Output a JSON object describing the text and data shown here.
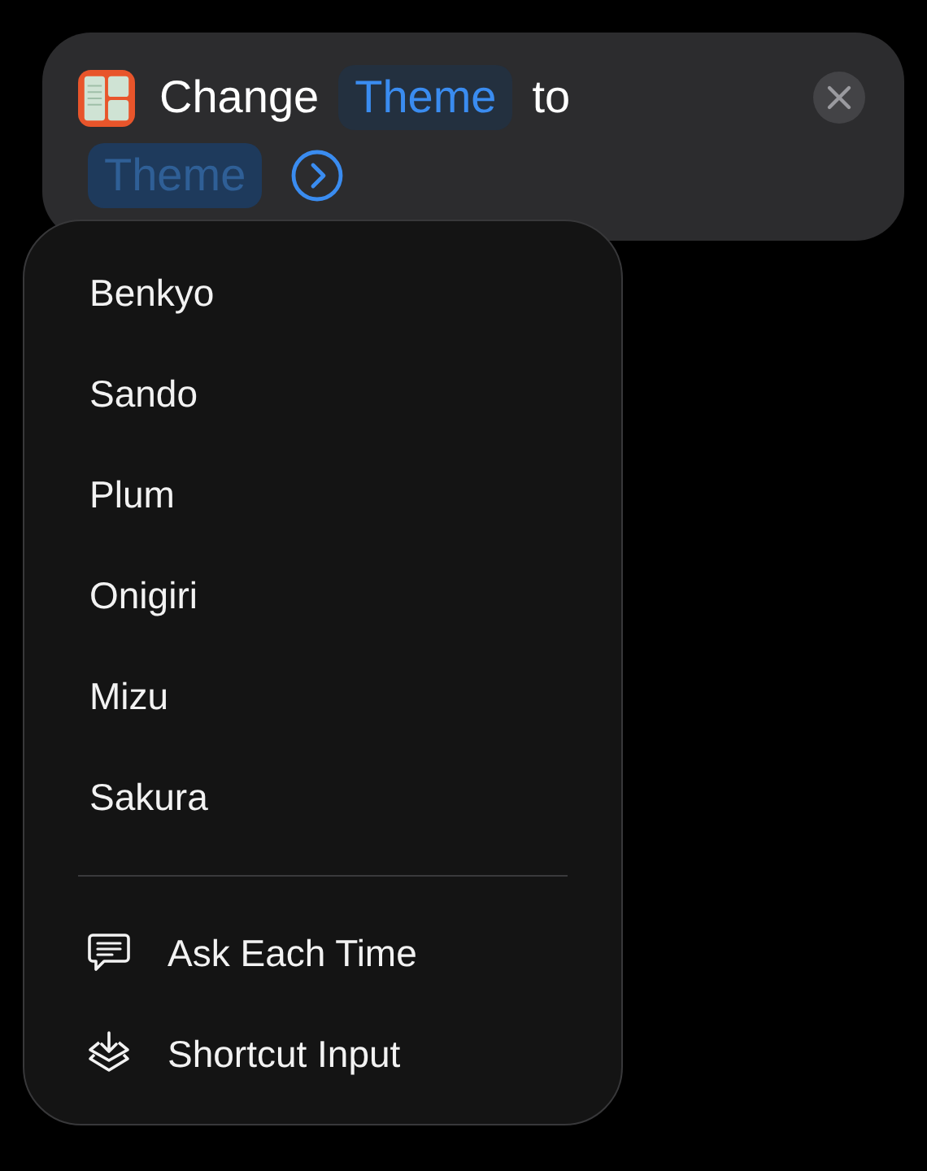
{
  "action": {
    "parts": [
      {
        "kind": "text",
        "text": "Change"
      },
      {
        "kind": "token",
        "text": "Theme",
        "dimmed": false
      },
      {
        "kind": "text",
        "text": "to"
      },
      {
        "kind": "token",
        "text": "Theme",
        "dimmed": true
      },
      {
        "kind": "arrow"
      }
    ]
  },
  "menu": {
    "options": [
      {
        "label": "Benkyo"
      },
      {
        "label": "Sando"
      },
      {
        "label": "Plum"
      },
      {
        "label": "Onigiri"
      },
      {
        "label": "Mizu"
      },
      {
        "label": "Sakura"
      }
    ],
    "variables": [
      {
        "kind": "ask",
        "label": "Ask Each Time"
      },
      {
        "kind": "input",
        "label": "Shortcut Input"
      }
    ]
  }
}
